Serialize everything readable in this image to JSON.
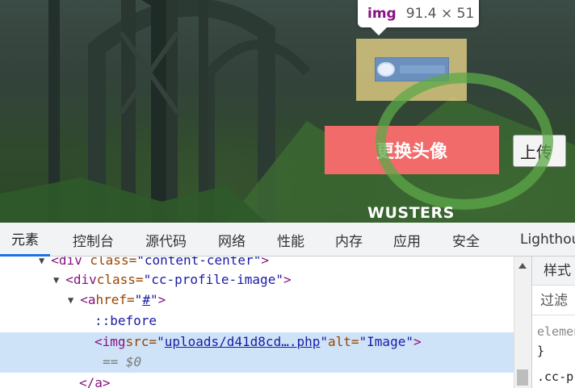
{
  "inspect_tooltip": {
    "tag": "img",
    "size": "91.4 × 51"
  },
  "page": {
    "change_avatar_label": "更换头像",
    "upload_label": "上传",
    "site_logo": "WUSTERS"
  },
  "devtools": {
    "tabs": [
      "元素",
      "控制台",
      "源代码",
      "网络",
      "性能",
      "内存",
      "应用",
      "安全",
      "Lighthouse"
    ],
    "active_tab": "元素",
    "dom": {
      "line0": {
        "tag_open": "<div",
        "attr": "class=",
        "val": "\"content-center\"",
        "close": ">"
      },
      "line1": {
        "tag_open": "<div",
        "attr": " class=",
        "val": "\"cc-profile-image\"",
        "close": ">"
      },
      "line2": {
        "tag_open": "<a",
        "attr": " href=",
        "val": "\"",
        "link": "#",
        "val_end": "\"",
        "close": ">"
      },
      "line3": {
        "pseudo": "::before"
      },
      "line4": {
        "tag_open": "<img",
        "attr1": " src=",
        "q1": "\"",
        "link": "uploads/d41d8cd….php",
        "q2": "\"",
        "attr2": " alt=",
        "val2": "\"Image\"",
        "close": ">"
      },
      "line5": {
        "marker": "== $0"
      },
      "line6": {
        "tag_close": "</a>"
      }
    },
    "styles": {
      "tab_label": "样式",
      "filter_placeholder": "过滤",
      "rule1_selector": "element.style",
      "rule1_close": "}",
      "rule2_selector": ".cc-profile-image"
    }
  },
  "colors": {
    "accent": "#1a73e8",
    "button": "#f26b6b",
    "selection": "#cfe3f8",
    "tag": "#881280"
  }
}
